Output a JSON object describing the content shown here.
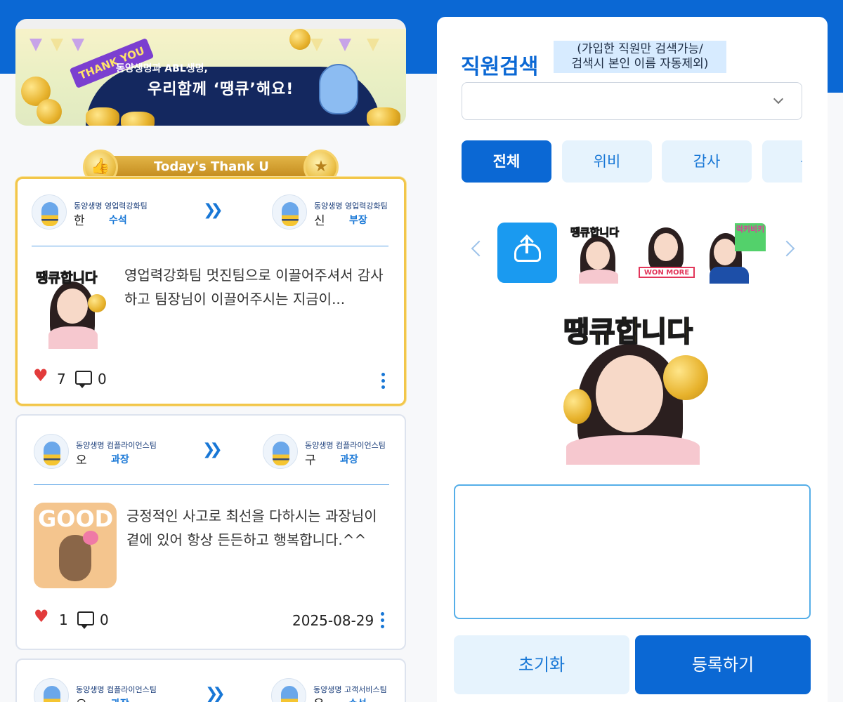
{
  "banner": {
    "ribbon": "THANK YOU",
    "line1": "동양생명과 ABL생명,",
    "line2": "우리함께 ‘땡큐’해요!"
  },
  "today": {
    "title": "Today's Thank U"
  },
  "cards": [
    {
      "from": {
        "org": "동양생명 영업력강화팀",
        "name": "한",
        "rank": "수석"
      },
      "to": {
        "org": "동양생명 영업력강화팀",
        "name": "신",
        "rank": "부장"
      },
      "sticker_text": "땡큐합니다",
      "message": "영업력강화팀 멋진팀으로 이끌어주셔서 감사하고 팀장님이 이끌어주시는 지금이...",
      "likes": "7",
      "comments": "0",
      "date": ""
    },
    {
      "from": {
        "org": "동양생명 컴플라이언스팀",
        "name": "오",
        "rank": "과장"
      },
      "to": {
        "org": "동양생명 컴플라이언스팀",
        "name": "구",
        "rank": "과장"
      },
      "sticker_text": "GOOD",
      "message": "긍정적인 사고로 최선을 다하시는 과장님이 곁에 있어 항상 든든하고 행복합니다.^^",
      "likes": "1",
      "comments": "0",
      "date": "2025-08-29"
    },
    {
      "from": {
        "org": "동양생명 컴플라이언스팀",
        "name": "오",
        "rank": "과장"
      },
      "to": {
        "org": "동양생명 고객서비스팀",
        "name": "윤",
        "rank": "수석"
      }
    }
  ],
  "panel": {
    "title": "직원검색",
    "hint_line1": "(가입한 직원만 검색가능/",
    "hint_line2": "검색시 본인 이름 자동제외)",
    "select_value": "",
    "chips": [
      "전체",
      "위비",
      "감사",
      "응"
    ],
    "thumb_texts": [
      "땡큐합니다",
      "WON MORE",
      "럭키비키"
    ],
    "preview_text": "땡큐합니다",
    "textarea_value": "",
    "reset_label": "초기화",
    "submit_label": "등록하기"
  },
  "colors": {
    "brand": "#0b68d4",
    "accent_light": "#e6f3fd",
    "gold": "#f2c64a",
    "heart": "#e23b3b"
  },
  "icons": [
    "upload-icon",
    "heart-icon",
    "comment-icon",
    "kebab-icon",
    "chevron-down-icon",
    "arrow-right-icon"
  ]
}
